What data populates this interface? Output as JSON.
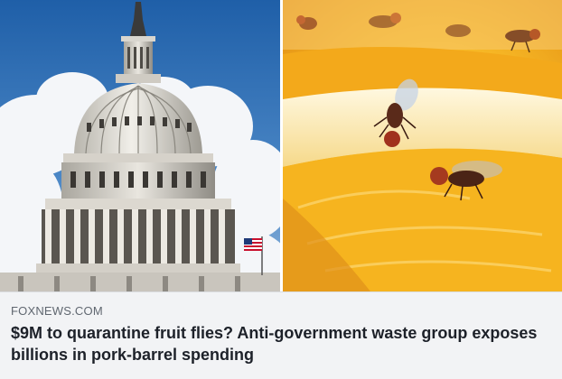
{
  "link_preview": {
    "domain": "FOXNEWS.COM",
    "headline": "$9M to quarantine fruit flies? Anti-government waste group exposes billions in pork-barrel spending",
    "image_left_subject": "capitol-dome",
    "image_right_subject": "fruit-flies-on-orange"
  },
  "colors": {
    "caption_background": "#f2f3f5",
    "domain_text": "#606770",
    "headline_text": "#1d2129",
    "sky_blue": "#2f6fb3",
    "orange": "#f5b21e"
  }
}
